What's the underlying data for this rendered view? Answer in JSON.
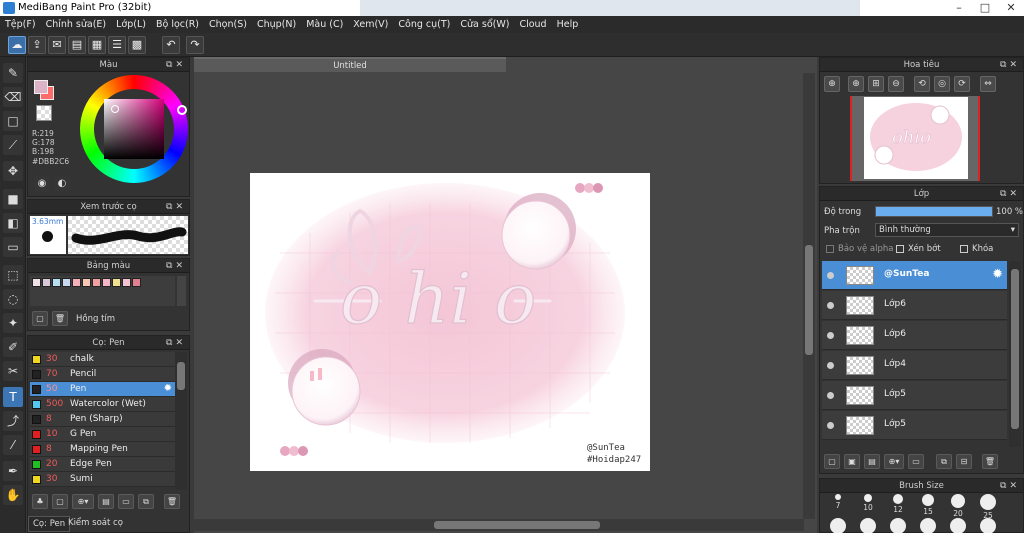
{
  "window": {
    "title": "MediBang Paint Pro (32bit)"
  },
  "menu": [
    "Tệp(F)",
    "Chỉnh sửa(E)",
    "Lớp(L)",
    "Bộ lọc(R)",
    "Chọn(S)",
    "Chụp(N)",
    "Màu (C)",
    "Xem(V)",
    "Công cụ(T)",
    "Cửa sổ(W)",
    "Cloud",
    "Help"
  ],
  "color_panel": {
    "title": "Màu",
    "r": "R:219",
    "g": "G:178",
    "b": "B:198",
    "hex": "#DBB2C6",
    "fg_color": "#DBB2C6",
    "bg_color": "#ff6b6b"
  },
  "preview_panel": {
    "title": "Xem trước cọ",
    "size": "3.63mm"
  },
  "palette_panel": {
    "title": "Bảng màu",
    "colors": [
      "#f0e1e8",
      "#d8c8d8",
      "#b6e0f2",
      "#c8d8f0",
      "#f3b0b8",
      "#f7c7b6",
      "#f0a0a0",
      "#f4b6c7",
      "#f0e090",
      "#f4c2d0",
      "#e08090"
    ],
    "palette_name": "Hồng tím"
  },
  "brush_panel": {
    "title": "Cọ: Pen",
    "brushes": [
      {
        "size": "30",
        "name": "chalk",
        "color": "#f0d820"
      },
      {
        "size": "70",
        "name": "Pencil",
        "color": "#222222"
      },
      {
        "size": "50",
        "name": "Pen",
        "color": "#222222"
      },
      {
        "size": "500",
        "name": "Watercolor (Wet)",
        "color": "#55c8f0"
      },
      {
        "size": "8",
        "name": "Pen (Sharp)",
        "color": "#222222"
      },
      {
        "size": "10",
        "name": "G Pen",
        "color": "#e02020"
      },
      {
        "size": "8",
        "name": "Mapping Pen",
        "color": "#e02020"
      },
      {
        "size": "20",
        "name": "Edge Pen",
        "color": "#20c020"
      },
      {
        "size": "30",
        "name": "Sumi",
        "color": "#f0d820"
      }
    ],
    "tab_brush": "Cọ: Pen",
    "tab_control": "Kiểm soát cọ"
  },
  "document": {
    "tab": "Untitled"
  },
  "canvas_art": {
    "handle": "@SunTea",
    "hashtag": "#Hoidap247",
    "word": "o hi o"
  },
  "navigator_panel": {
    "title": "Hoa tiêu"
  },
  "layer_panel": {
    "title": "Lớp",
    "opacity_label": "Độ trong",
    "opacity_value": "100 %",
    "opacity_percent": 100,
    "blend_label": "Pha trộn",
    "blend_value": "Bình thường",
    "protect_alpha": "Bảo vệ alpha",
    "clipping": "Xén bớt",
    "lock": "Khóa",
    "layers": [
      "@SunTea",
      "Lớp6",
      "Lớp6",
      "Lớp4",
      "Lớp5",
      "Lớp5"
    ]
  },
  "brush_size_panel": {
    "title": "Brush Size",
    "sizes": [
      "7",
      "10",
      "12",
      "15",
      "20",
      "25"
    ]
  }
}
